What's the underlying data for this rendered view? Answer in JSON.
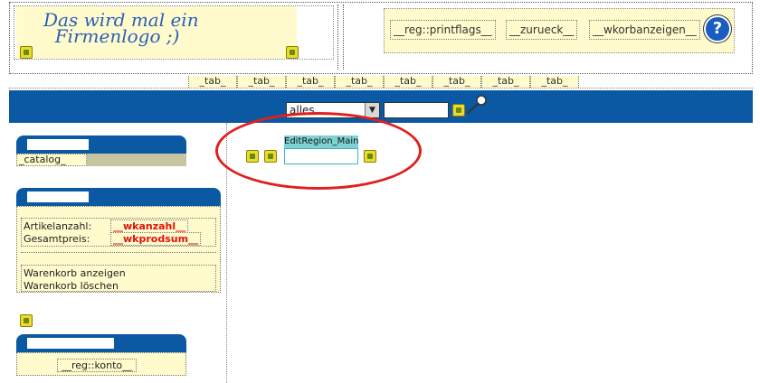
{
  "header": {
    "logo_text_line1": "Das wird mal ein",
    "logo_text_line2": "Firmenlogo ;)",
    "buttons": [
      {
        "label": "__reg::printflags__"
      },
      {
        "label": "__zurueck__"
      },
      {
        "label": "__wkorbanzeigen__"
      }
    ],
    "help_glyph": "?"
  },
  "tabs": [
    "_tab_",
    "_tab_",
    "_tab_",
    "_tab_",
    "_tab_",
    "_tab_",
    "_tab_",
    "_tab_"
  ],
  "search": {
    "select_value": "alles",
    "input_value": ""
  },
  "sidebar": {
    "catalog_panel": {
      "link_label": "_catalog_"
    },
    "basket_panel": {
      "count_label": "Artikelanzahl:",
      "count_value": "__wkanzahl__",
      "total_label": "Gesamtpreis:",
      "total_value": "__wkprodsum__",
      "show_label": "Warenkorb anzeigen",
      "clear_label": "Warenkorb löschen"
    },
    "account_panel": {
      "link_label": "__reg::konto__"
    }
  },
  "main": {
    "edit_region_label": "EditRegion_Main"
  },
  "colors": {
    "blue_bar": "#0a59a2",
    "panel_yellow": "#fffbcc",
    "highlight_red": "#e0201e",
    "edit_region_cyan": "#7fd2d4"
  }
}
